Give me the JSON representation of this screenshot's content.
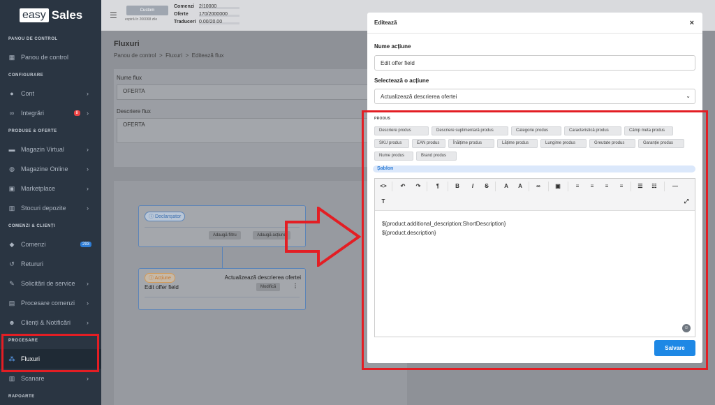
{
  "brand": {
    "easy": "easy",
    "sales": "Sales"
  },
  "sidebar": {
    "sections": [
      "PANOU DE CONTROL",
      "CONFIGURARE",
      "PRODUSE & OFERTE",
      "COMENZI & CLIENȚI",
      "PROCESARE",
      "RAPOARTE"
    ],
    "items": [
      {
        "label": "Panou de control",
        "icon": "dashboard-icon"
      },
      {
        "label": "Cont",
        "icon": "user-icon"
      },
      {
        "label": "Integrări",
        "icon": "link-icon",
        "badge": "8"
      },
      {
        "label": "Magazin Virtual",
        "icon": "store-icon"
      },
      {
        "label": "Magazine Online",
        "icon": "globe-icon"
      },
      {
        "label": "Marketplace",
        "icon": "marketplace-icon"
      },
      {
        "label": "Stocuri depozite",
        "icon": "warehouse-icon"
      },
      {
        "label": "Comenzi",
        "icon": "orders-icon",
        "badge": "293"
      },
      {
        "label": "Retururi",
        "icon": "return-icon"
      },
      {
        "label": "Solicitări de service",
        "icon": "wrench-icon"
      },
      {
        "label": "Procesare comenzi",
        "icon": "processing-icon"
      },
      {
        "label": "Clienți & Notificări",
        "icon": "clients-icon"
      },
      {
        "label": "Fluxuri",
        "icon": "flow-icon"
      },
      {
        "label": "Scanare",
        "icon": "scan-icon"
      }
    ]
  },
  "topbar": {
    "plan": "Custom",
    "plan_expiry": "expiră în 200068 zile",
    "stats": [
      {
        "label": "Comenzi",
        "value": "2/10000"
      },
      {
        "label": "Oferte",
        "value": "170/2000000"
      },
      {
        "label": "Traduceri",
        "value": "0.00/20.00"
      }
    ]
  },
  "page": {
    "title": "Fluxuri",
    "breadcrumb": [
      "Panou de control",
      "Fluxuri",
      "Editează flux"
    ],
    "name_label": "Nume flux",
    "name_value": "OFERTA",
    "desc_label": "Descriere flux",
    "desc_value": "OFERTA"
  },
  "flow": {
    "trigger_pill": "Declanșator",
    "add_filter": "Adaugă filtru",
    "add_action": "Adaugă acțiune",
    "action_pill": "Acțiune",
    "action_title": "Actualizează descrierea ofertei",
    "action_name": "Edit offer field",
    "modify": "Modifică"
  },
  "modal": {
    "title": "Editează",
    "close": "×",
    "action_name_label": "Nume acțiune",
    "action_name_value": "Edit offer field",
    "select_label": "Selectează o acțiune",
    "select_value": "Actualizează descrierea ofertei",
    "product_section": "PRODUS",
    "chips": [
      "Descriere produs",
      "Descriere suplimentară produs",
      "Categorie produs",
      "Caracteristică produs",
      "Câmp meta produs",
      "SKU produs",
      "EAN produs",
      "Înălțime produs",
      "Lățime produs",
      "Lungime produs",
      "Greutate produs",
      "Garanție produs",
      "Nume produs",
      "Brand produs"
    ],
    "template_label": "Șablon",
    "editor_lines": [
      "${product.additional_description;ShortDescription}",
      "${product.description}"
    ],
    "save": "Salvare"
  },
  "colors": {
    "highlight": "#e31e24",
    "primary": "#1e88e5",
    "sidebar": "#2a3542"
  }
}
